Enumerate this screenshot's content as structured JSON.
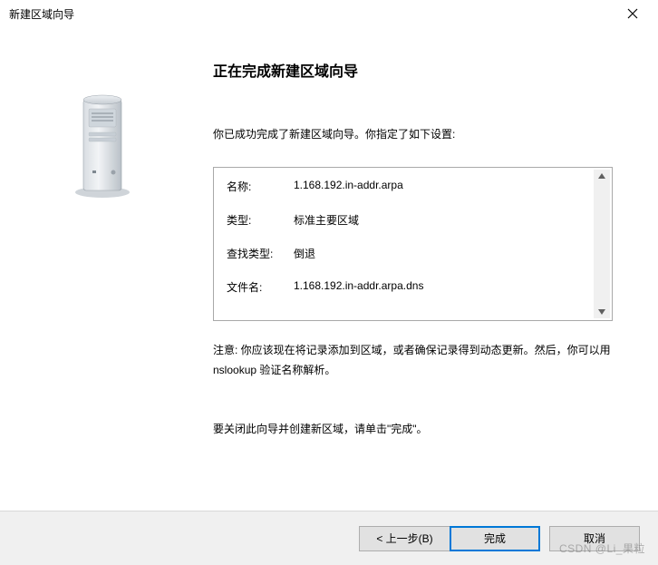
{
  "window": {
    "title": "新建区域向导"
  },
  "heading": "正在完成新建区域向导",
  "intro": "你已成功完成了新建区域向导。你指定了如下设置:",
  "summary": {
    "rows": [
      {
        "label": "名称:",
        "value": "1.168.192.in-addr.arpa"
      },
      {
        "label": "类型:",
        "value": "标准主要区域"
      },
      {
        "label": "查找类型:",
        "value": "倒退"
      },
      {
        "label": "文件名:",
        "value": "1.168.192.in-addr.arpa.dns"
      }
    ]
  },
  "note": "注意: 你应该现在将记录添加到区域，或者确保记录得到动态更新。然后，你可以用 nslookup 验证名称解析。",
  "close_instruction": "要关闭此向导并创建新区域，请单击\"完成\"。",
  "buttons": {
    "back": "< 上一步(B)",
    "finish": "完成",
    "cancel": "取消"
  },
  "watermark": "CSDN @Li_果粒"
}
